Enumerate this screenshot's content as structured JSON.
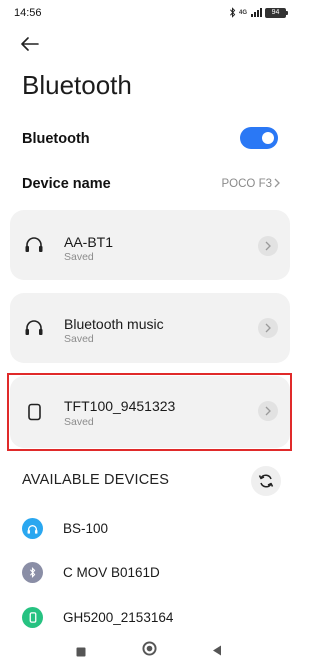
{
  "status_bar": {
    "time": "14:56",
    "network": "4G",
    "battery": "94",
    "icons": [
      "bluetooth-icon",
      "signal-icon",
      "battery-icon"
    ]
  },
  "header": {
    "title": "Bluetooth",
    "back_icon": "arrow-left-icon"
  },
  "settings": {
    "bluetooth_label": "Bluetooth",
    "bluetooth_enabled": true,
    "device_name_label": "Device name",
    "device_name_value": "POCO F3"
  },
  "paired_devices": [
    {
      "name": "AA-BT1",
      "status": "Saved",
      "icon": "headphones-icon"
    },
    {
      "name": "Bluetooth music",
      "status": "Saved",
      "icon": "headphones-icon"
    },
    {
      "name": "TFT100_9451323",
      "status": "Saved",
      "icon": "device-square-icon"
    }
  ],
  "available": {
    "header": "AVAILABLE DEVICES",
    "refresh_icon": "refresh-icon",
    "devices": [
      {
        "name": "BS-100",
        "icon": "headphones-icon",
        "color": "#2aa7f0"
      },
      {
        "name": "C MOV B0161D",
        "icon": "bluetooth-icon",
        "color": "#8a8ea6"
      },
      {
        "name": "GH5200_2153164",
        "icon": "phone-icon",
        "color": "#26c281"
      }
    ]
  },
  "colors": {
    "accent": "#2a78f5",
    "highlight": "#e02a2a"
  }
}
